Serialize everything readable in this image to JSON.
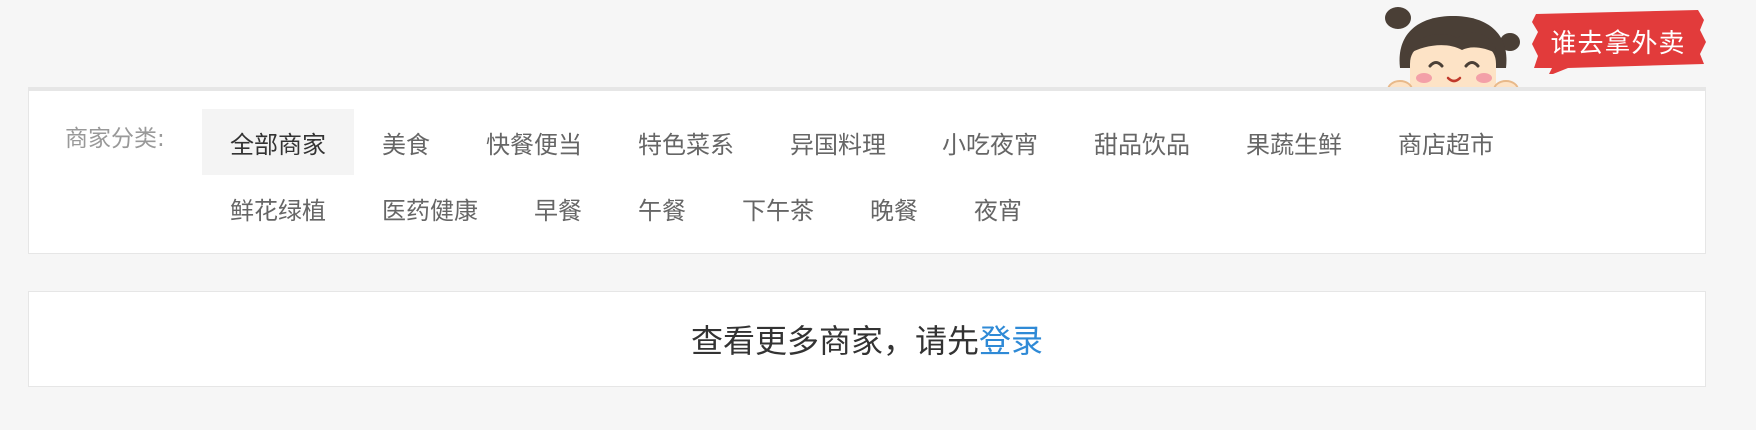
{
  "badge": {
    "text": "谁去拿外卖",
    "color": "#e23b3b"
  },
  "categories": {
    "label": "商家分类:",
    "active_index": 0,
    "rows": [
      [
        "全部商家",
        "美食",
        "快餐便当",
        "特色菜系",
        "异国料理",
        "小吃夜宵",
        "甜品饮品",
        "果蔬生鲜",
        "商店超市"
      ],
      [
        "鲜花绿植",
        "医药健康",
        "早餐",
        "午餐",
        "下午茶",
        "晚餐",
        "夜宵"
      ]
    ]
  },
  "login_prompt": {
    "text": "查看更多商家，请先",
    "link_text": "登录",
    "link_color": "#2f8ad6"
  },
  "icons": {
    "mascot": "girl-mascot-illustration"
  }
}
